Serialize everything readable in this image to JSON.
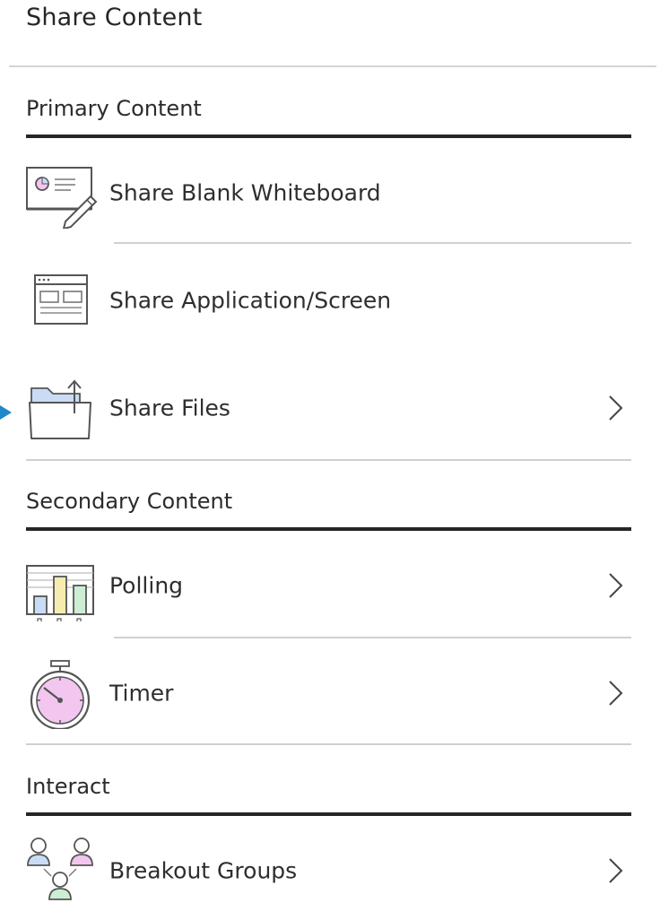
{
  "panel": {
    "title": "Share Content"
  },
  "sections": {
    "primary": {
      "heading": "Primary Content",
      "items": [
        {
          "label": "Share Blank Whiteboard",
          "icon": "whiteboard-icon",
          "has_submenu": false
        },
        {
          "label": "Share Application/Screen",
          "icon": "application-screen-icon",
          "has_submenu": false
        },
        {
          "label": "Share Files",
          "icon": "folder-upload-icon",
          "has_submenu": true
        }
      ]
    },
    "secondary": {
      "heading": "Secondary Content",
      "items": [
        {
          "label": "Polling",
          "icon": "poll-chart-icon",
          "has_submenu": true
        },
        {
          "label": "Timer",
          "icon": "stopwatch-icon",
          "has_submenu": true
        }
      ]
    },
    "interact": {
      "heading": "Interact",
      "items": [
        {
          "label": "Breakout Groups",
          "icon": "breakout-groups-icon",
          "has_submenu": true
        }
      ]
    }
  },
  "colors": {
    "text": "#262626",
    "rule": "#262626",
    "separator": "#d0d0d0",
    "focus_arrow": "#1e88c8",
    "icon_pink": "#f2c6ef",
    "icon_blue": "#c9dcf5",
    "icon_yellow": "#f6ecb0",
    "icon_green": "#cdeed4",
    "icon_stroke": "#555555"
  }
}
